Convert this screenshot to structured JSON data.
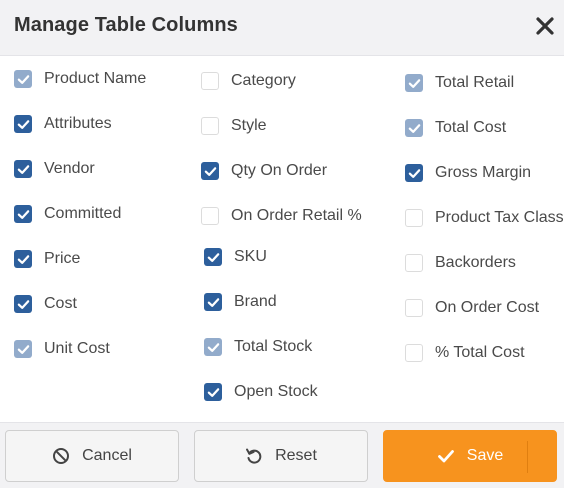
{
  "dialog": {
    "title": "Manage Table Columns",
    "close_icon": "close-icon"
  },
  "colors": {
    "checked": "#2d5f9c",
    "checked_disabled": "#92abcb",
    "save": "#f7931e"
  },
  "columns": [
    {
      "label": "Product Name",
      "state": "checked-disabled"
    },
    {
      "label": "Attributes",
      "state": "checked"
    },
    {
      "label": "Vendor",
      "state": "checked"
    },
    {
      "label": "Committed",
      "state": "checked"
    },
    {
      "label": "Price",
      "state": "checked"
    },
    {
      "label": "Cost",
      "state": "checked"
    },
    {
      "label": "Unit Cost",
      "state": "checked-disabled"
    },
    {
      "label": "Category",
      "state": "unchecked"
    },
    {
      "label": "Style",
      "state": "unchecked"
    },
    {
      "label": "Qty On Order",
      "state": "checked"
    },
    {
      "label": "On Order Retail %",
      "state": "unchecked"
    },
    {
      "label": "SKU",
      "state": "checked"
    },
    {
      "label": "Brand",
      "state": "checked"
    },
    {
      "label": "Total Stock",
      "state": "checked-disabled"
    },
    {
      "label": "Open Stock",
      "state": "checked"
    },
    {
      "label": "Total Retail",
      "state": "checked-disabled"
    },
    {
      "label": "Total Cost",
      "state": "checked-disabled"
    },
    {
      "label": "Gross Margin",
      "state": "checked"
    },
    {
      "label": "Product Tax Class",
      "state": "unchecked"
    },
    {
      "label": "Backorders",
      "state": "unchecked"
    },
    {
      "label": "On Order Cost",
      "state": "unchecked"
    },
    {
      "label": "% Total Cost",
      "state": "unchecked"
    }
  ],
  "footer": {
    "cancel_label": "Cancel",
    "cancel_icon": "ban-icon",
    "reset_label": "Reset",
    "reset_icon": "undo-icon",
    "save_label": "Save",
    "save_icon": "check-icon"
  }
}
